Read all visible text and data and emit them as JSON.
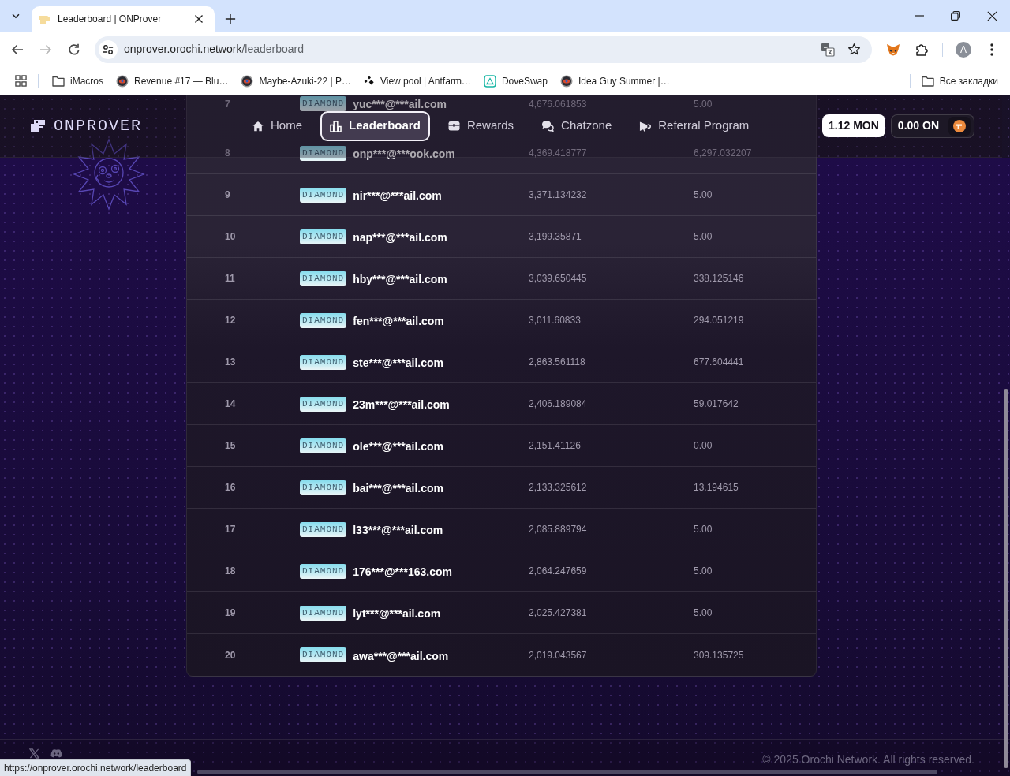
{
  "browser": {
    "tabs": [
      {
        "title": "Leaderboard | ONProver",
        "selected": true
      }
    ],
    "forward_disabled": true,
    "url_host": "onprover.orochi.network",
    "url_path": "/leaderboard",
    "profile_initial": "A",
    "bookmarks": [
      {
        "kind": "folder",
        "label": "iMacros"
      },
      {
        "kind": "orb",
        "label": "Revenue #17 — Blu…"
      },
      {
        "kind": "orb",
        "label": "Maybe-Azuki-22 | P…"
      },
      {
        "kind": "dots",
        "label": "View pool | Antfarm…"
      },
      {
        "kind": "tile",
        "label": "DoveSwap"
      },
      {
        "kind": "orb",
        "label": "Idea Guy Summer |…"
      }
    ],
    "all_bookmarks": "Все закладки"
  },
  "header": {
    "logo": "ONPROVER",
    "nav": [
      {
        "label": "Home",
        "selected": false
      },
      {
        "label": "Leaderboard",
        "selected": true
      },
      {
        "label": "Rewards",
        "selected": false
      },
      {
        "label": "Chatzone",
        "selected": false
      },
      {
        "label": "Referral Program",
        "selected": false
      }
    ],
    "wallet_balance": "1.12 MON",
    "token_balance": "0.00 ON"
  },
  "leaderboard": {
    "rows": [
      {
        "column_1": "7",
        "badge": "DIAMOND",
        "column_2": "yuc***@***ail.com",
        "column_3": "4,676.061853",
        "column_4": "5.00"
      },
      {
        "column_1": "8",
        "badge": "DIAMOND",
        "column_2": "onp***@***ook.com",
        "column_3": "4,369.418777",
        "column_4": "6,297.032207"
      },
      {
        "column_1": "9",
        "badge": "DIAMOND",
        "column_2": "nir***@***ail.com",
        "column_3": "3,371.134232",
        "column_4": "5.00"
      },
      {
        "column_1": "10",
        "badge": "DIAMOND",
        "column_2": "nap***@***ail.com",
        "column_3": "3,199.35871",
        "column_4": "5.00"
      },
      {
        "column_1": "11",
        "badge": "DIAMOND",
        "column_2": "hby***@***ail.com",
        "column_3": "3,039.650445",
        "column_4": "338.125146"
      },
      {
        "column_1": "12",
        "badge": "DIAMOND",
        "column_2": "fen***@***ail.com",
        "column_3": "3,011.60833",
        "column_4": "294.051219"
      },
      {
        "column_1": "13",
        "badge": "DIAMOND",
        "column_2": "ste***@***ail.com",
        "column_3": "2,863.561118",
        "column_4": "677.604441"
      },
      {
        "column_1": "14",
        "badge": "DIAMOND",
        "column_2": "23m***@***ail.com",
        "column_3": "2,406.189084",
        "column_4": "59.017642"
      },
      {
        "column_1": "15",
        "badge": "DIAMOND",
        "column_2": "ole***@***ail.com",
        "column_3": "2,151.41126",
        "column_4": "0.00"
      },
      {
        "column_1": "16",
        "badge": "DIAMOND",
        "column_2": "bai***@***ail.com",
        "column_3": "2,133.325612",
        "column_4": "13.194615"
      },
      {
        "column_1": "17",
        "badge": "DIAMOND",
        "column_2": "l33***@***ail.com",
        "column_3": "2,085.889794",
        "column_4": "5.00"
      },
      {
        "column_1": "18",
        "badge": "DIAMOND",
        "column_2": "176***@***163.com",
        "column_3": "2,064.247659",
        "column_4": "5.00"
      },
      {
        "column_1": "19",
        "badge": "DIAMOND",
        "column_2": "lyt***@***ail.com",
        "column_3": "2,025.427381",
        "column_4": "5.00"
      },
      {
        "column_1": "20",
        "badge": "DIAMOND",
        "column_2": "awa***@***ail.com",
        "column_3": "2,019.043567",
        "column_4": "309.135725"
      }
    ]
  },
  "footer": {
    "copyright": "© 2025 Orochi Network. All rights reserved."
  },
  "status_url": "https://onprover.orochi.network/leaderboard"
}
